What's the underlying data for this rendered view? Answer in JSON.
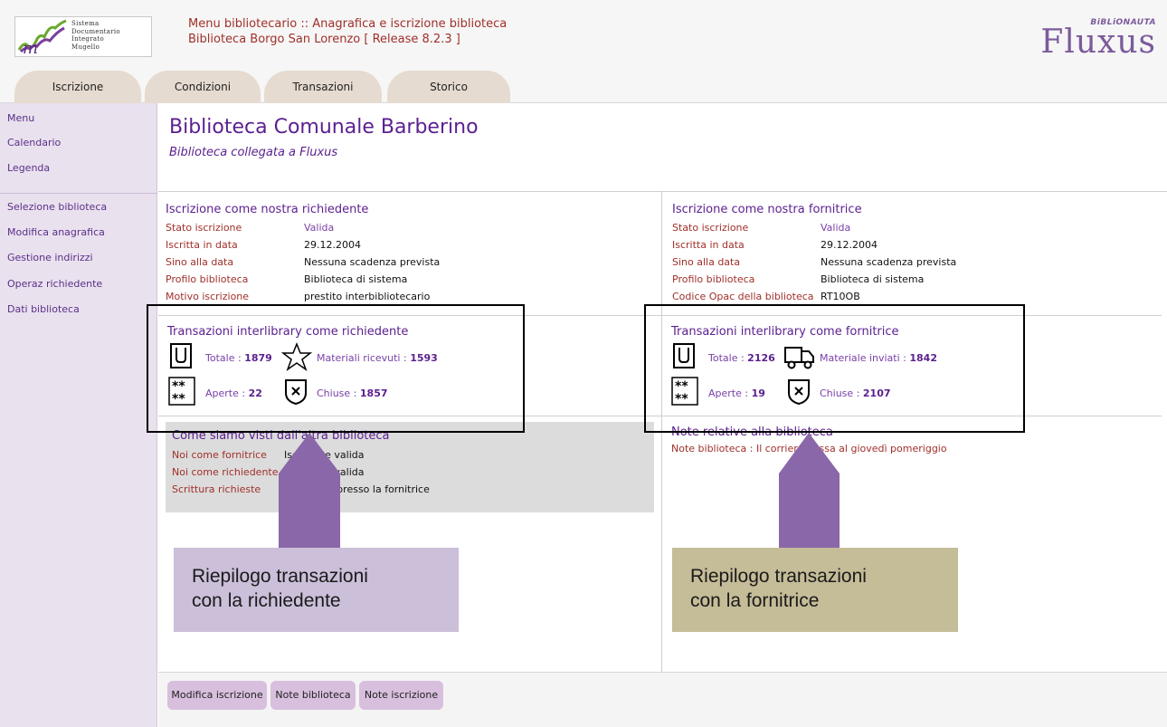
{
  "header": {
    "logo_lines": [
      "Sistema",
      "Documentario",
      "Integrato",
      "Mugello"
    ],
    "title_line1": "Menu bibliotecario :: Anagrafica e iscrizione biblioteca",
    "title_line2": "Biblioteca Borgo San Lorenzo [ Release 8.2.3 ]",
    "brand_tag": "BiBLiONAUTA",
    "brand_name": "Fluxus"
  },
  "tabs": [
    {
      "label": "Iscrizione"
    },
    {
      "label": "Condizioni"
    },
    {
      "label": "Transazioni"
    },
    {
      "label": "Storico"
    }
  ],
  "sidebar": {
    "items": [
      {
        "label": "Menu"
      },
      {
        "label": "Calendario"
      },
      {
        "label": "Legenda"
      },
      {
        "label": "Selezione biblioteca"
      },
      {
        "label": "Modifica anagrafica"
      },
      {
        "label": "Gestione indirizzi"
      },
      {
        "label": "Operaz richiedente"
      },
      {
        "label": "Dati biblioteca"
      }
    ]
  },
  "library": {
    "title": "Biblioteca Comunale Barberino",
    "subtitle": "Biblioteca collegata a Fluxus"
  },
  "left": {
    "title": "Iscrizione come nostra richiedente",
    "rows": [
      {
        "label": "Stato iscrizione",
        "value": "Valida"
      },
      {
        "label": "Iscritta in data",
        "value": "29.12.2004"
      },
      {
        "label": "Sino alla data",
        "value": "Nessuna scadenza prevista"
      },
      {
        "label": "Profilo biblioteca",
        "value": "Biblioteca di sistema"
      },
      {
        "label": "Motivo iscrizione",
        "value": "prestito interbibliotecario"
      }
    ],
    "tr_title": "Transazioni interlibrary come richiedente",
    "tr": {
      "totale_label": "Totale : ",
      "totale": "1879",
      "second_label": "Materiali ricevuti : ",
      "second": "1593",
      "aperte_label": "Aperte : ",
      "aperte": "22",
      "chiuse_label": "Chiuse : ",
      "chiuse": "1857"
    },
    "views_title": "Come siamo visti dall'altra biblioteca",
    "views": [
      {
        "label": "Noi come fornitrice",
        "value": "Iscrizione valida"
      },
      {
        "label": "Noi come richiedente",
        "value": "Iscrizione valida"
      },
      {
        "label": "Scrittura richieste",
        "value": "Effettuata presso la fornitrice"
      }
    ]
  },
  "right": {
    "title": "Iscrizione come nostra fornitrice",
    "rows": [
      {
        "label": "Stato iscrizione",
        "value": "Valida"
      },
      {
        "label": "Iscritta in data",
        "value": "29.12.2004"
      },
      {
        "label": "Sino alla data",
        "value": "Nessuna scadenza prevista"
      },
      {
        "label": "Profilo biblioteca",
        "value": "Biblioteca di sistema"
      },
      {
        "label": "Codice Opac della biblioteca",
        "value": "RT10OB"
      }
    ],
    "tr_title": "Transazioni interlibrary come fornitrice",
    "tr": {
      "totale_label": "Totale : ",
      "totale": "2126",
      "second_label": "Materiale inviati : ",
      "second": "1842",
      "aperte_label": "Aperte : ",
      "aperte": "19",
      "chiuse_label": "Chiuse : ",
      "chiuse": "2107"
    },
    "notes_title": "Note relative alla biblioteca",
    "notes_text": "Note biblioteca : Il corriere passa al giovedì pomeriggio"
  },
  "callouts": {
    "left_line1": "Riepilogo transazioni",
    "left_line2": "con la richiedente",
    "right_line1": "Riepilogo transazioni",
    "right_line2": "con la fornitrice",
    "left_bg": "#cbbfd9",
    "right_bg": "#c5bc98",
    "arrow_color": "#8a67a8"
  },
  "footer": {
    "buttons": [
      {
        "label": "Modifica iscrizione"
      },
      {
        "label": "Note biblioteca"
      },
      {
        "label": "Note iscrizione"
      }
    ]
  }
}
